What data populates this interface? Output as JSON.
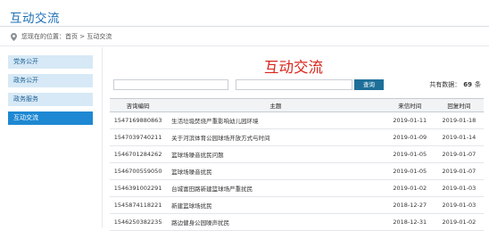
{
  "page": {
    "title": "互动交流"
  },
  "breadcrumb": {
    "text": "您现在的位置：首页 > 互动交流"
  },
  "sidebar": {
    "items": [
      {
        "label": "党务公开"
      },
      {
        "label": "政务公开"
      },
      {
        "label": "政务服务"
      },
      {
        "label": "互动交流"
      }
    ]
  },
  "main": {
    "title": "互动交流",
    "search_a": {
      "value": "",
      "placeholder": ""
    },
    "search_b": {
      "value": "",
      "placeholder": ""
    },
    "search_button": "查询",
    "total_prefix": "共有数据：",
    "total_count": "69",
    "total_suffix": "条"
  },
  "table": {
    "headers": [
      "咨询编码",
      "主题",
      "来信时间",
      "回复时间"
    ],
    "rows": [
      {
        "id": "1547169880863",
        "subject": "生活垃圾焚烧严重影响幼儿园环境",
        "received": "2019-01-11",
        "replied": "2019-01-18"
      },
      {
        "id": "1547039740211",
        "subject": "关于河滨体育公园球场开放方式与时间",
        "received": "2019-01-09",
        "replied": "2019-01-14"
      },
      {
        "id": "1546701284262",
        "subject": "篮球场噪音扰民问题",
        "received": "2019-01-05",
        "replied": "2019-01-07"
      },
      {
        "id": "1546700559050",
        "subject": "篮球场噪音扰民",
        "received": "2019-01-05",
        "replied": "2019-01-07"
      },
      {
        "id": "1546391002291",
        "subject": "台城富田路新建篮球场严重扰民",
        "received": "2019-01-02",
        "replied": "2019-01-03"
      },
      {
        "id": "1545874118221",
        "subject": "新建篮球场扰民",
        "received": "2018-12-27",
        "replied": "2019-01-03"
      },
      {
        "id": "1546250382235",
        "subject": "路边健身公园噪声扰民",
        "received": "2018-12-31",
        "replied": "2019-01-02"
      }
    ]
  }
}
